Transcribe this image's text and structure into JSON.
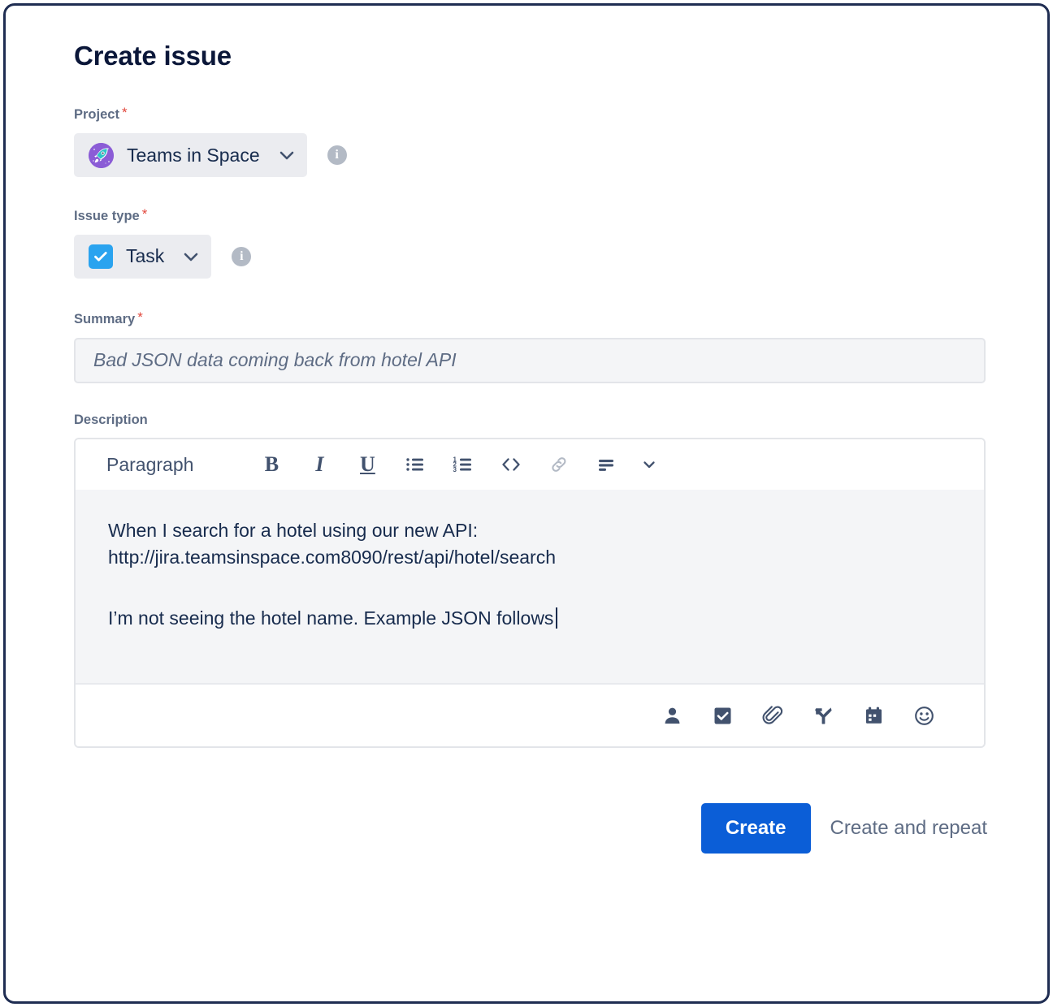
{
  "dialog": {
    "title": "Create issue"
  },
  "fields": {
    "project": {
      "label": "Project",
      "required_marker": "*",
      "value": "Teams in Space",
      "avatar_icon": "rocket-avatar-icon",
      "chevron_icon": "chevron-down-icon",
      "info_icon": "info-icon",
      "info_glyph": "i"
    },
    "issue_type": {
      "label": "Issue type",
      "required_marker": "*",
      "value": "Task",
      "type_icon": "task-checkbox-icon",
      "chevron_icon": "chevron-down-icon",
      "info_icon": "info-icon",
      "info_glyph": "i"
    },
    "summary": {
      "label": "Summary",
      "required_marker": "*",
      "value": "",
      "placeholder": "Bad JSON data coming back from hotel API"
    },
    "description": {
      "label": "Description",
      "toolbar": {
        "block_type": "Paragraph",
        "bold_label": "B",
        "italic_label": "I",
        "underline_label": "U",
        "bullet_list_icon": "bullet-list-icon",
        "numbered_list_icon": "numbered-list-icon",
        "code_icon": "code-icon",
        "link_icon": "link-icon",
        "align_icon": "align-left-icon",
        "more_icon": "chevron-down-icon"
      },
      "content": {
        "paragraph_1": "When I search for a hotel using our new API: http://jira.teamsinspace.com8090/rest/api/hotel/search",
        "paragraph_1_line_1": "When I search for a hotel using our new API:",
        "paragraph_1_line_2": "http://jira.teamsinspace.com8090/rest/api/hotel/search",
        "paragraph_2": "I’m not seeing the hotel name. Example JSON follows"
      },
      "footer_icons": [
        "mention-person-icon",
        "action-item-checkbox-icon",
        "attachment-paperclip-icon",
        "branch-decision-icon",
        "date-calendar-icon",
        "emoji-smiley-icon"
      ]
    }
  },
  "actions": {
    "create_label": "Create",
    "create_and_repeat_label": "Create and repeat"
  },
  "colors": {
    "primary_button": "#0b5ed7",
    "required_asterisk": "#e2483d",
    "label_text": "#5e6c84",
    "body_text": "#172b4d",
    "field_fill": "#f4f5f7",
    "pill_fill": "#ebecf0",
    "frame_border": "#1f2d52",
    "task_icon": "#2aa3ef",
    "project_avatar": "#8b5cd6"
  }
}
